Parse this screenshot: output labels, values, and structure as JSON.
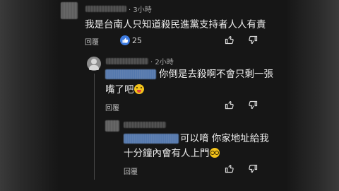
{
  "comments": [
    {
      "time": "· 3小時",
      "text": "我是台南人只知道殺民進黨支持者人人有責",
      "reply_label": "回覆",
      "like_count": "25"
    },
    {
      "time": "· 2小時",
      "text_line1": "你倒是去殺啊不會只剩一張",
      "text_line2": "嘴了吧",
      "reply_label": "回覆"
    },
    {
      "text_line1": "可以唷 你家地址給我",
      "text_line2": "十分鐘內會有人上門",
      "reply_label": "回覆"
    }
  ],
  "icons": {
    "like": "thumbs-up-icon",
    "dislike": "thumbs-down-icon",
    "liked_badge": "blue-thumbs-up-icon"
  },
  "colors": {
    "background": "#161616",
    "text": "#ededed",
    "meta": "#a7a7a7",
    "accent_blue": "#3d7be0"
  }
}
